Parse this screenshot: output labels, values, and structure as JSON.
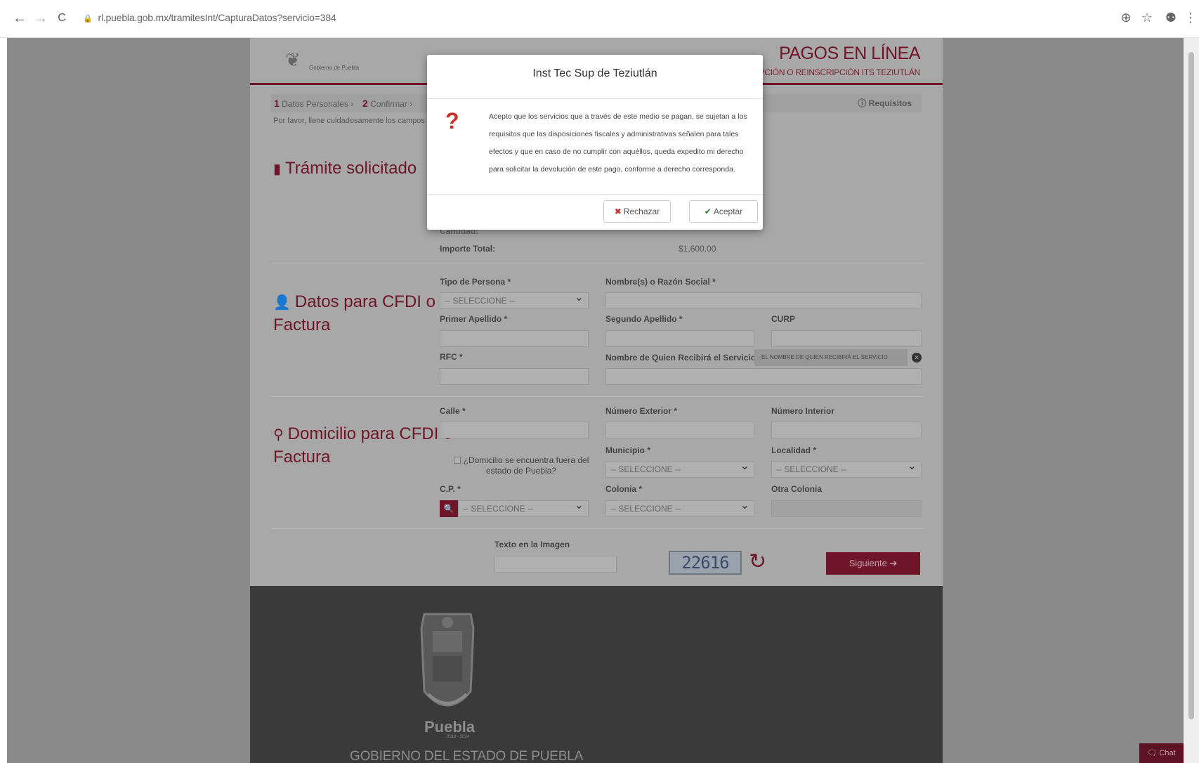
{
  "browser": {
    "url": "rl.puebla.gob.mx/tramitesInt/CapturaDatos?servicio=384",
    "back_icon": "←",
    "forward_icon": "→",
    "reload_icon": "C",
    "zoom_icon": "⊕",
    "star_icon": "☆",
    "profile_icon": "⚉",
    "menu_icon": "⋮"
  },
  "header": {
    "brand_title": "PAGOS EN LÍNEA",
    "brand_sub": "RIPCIÓN O REINSCRIPCIÓN ITS TEZIUTLÁN",
    "logo_text": "Gobierno de Puebla"
  },
  "steps": {
    "step1_num": "1",
    "step1_label": "Datos Personales",
    "step2_num": "2",
    "step2_label": "Confirmar",
    "requisitos": "Requisitos",
    "intro": "Por favor, llene cuidadosamente los campos"
  },
  "tramite": {
    "title": "Trámite solicitado",
    "cantidad_label": "Cantidad:",
    "importe_label": "Importe Total:",
    "importe_value": "$1,600.00"
  },
  "cfdi": {
    "title_line1": "Datos para CFDI o",
    "title_line2": "Factura",
    "tipo_persona_label": "Tipo de Persona *",
    "tipo_persona_value": "-- SELECCIONE --",
    "nombre_label": "Nombre(s) o Razón Social *",
    "primer_apellido_label": "Primer Apellido *",
    "segundo_apellido_label": "Segundo Apellido *",
    "curp_label": "CURP",
    "rfc_label": "RFC *",
    "recibe_label": "Nombre de Quien Recibirá el Servicio",
    "recibe_tag": "EL NOMBRE DE QUIEN RECIBIRÁ EL SERVICIO"
  },
  "domicilio": {
    "title_line1": "Domicilio para CFDI o",
    "title_line2": "Factura",
    "calle_label": "Calle *",
    "num_ext_label": "Número Exterior *",
    "num_int_label": "Número Interior",
    "fuera_line1": "¿Domicilio se encuentra fuera del",
    "fuera_line2": "estado de Puebla?",
    "municipio_label": "Municipio *",
    "municipio_value": "-- SELECCIONE --",
    "localidad_label": "Localidad *",
    "localidad_value": "-- SELECCIONE --",
    "cp_label": "C.P. *",
    "cp_value": "-- SELECCIONE --",
    "colonia_label": "Colonia *",
    "colonia_value": "-- SELECCIONE --",
    "otra_colonia_label": "Otra Colonia"
  },
  "captcha": {
    "label": "Texto en la Imagen",
    "code": "22616",
    "siguiente": "Siguiente ➔"
  },
  "footer": {
    "puebla": "Puebla",
    "years": "2019 - 2024",
    "gob": "GOBIERNO DEL ESTADO DE PUEBLA",
    "chat": "Chat"
  },
  "modal": {
    "title": "Inst Tec Sup de Teziutlán",
    "body_line1": "Acepto que los servicios que a través de este medio se pagan, se sujetan a los",
    "body_line2": "requisitos que las disposiciones fiscales y administrativas señalen para tales",
    "body_line3": "efectos y que en caso de no cumplir con aquéllos, queda expedito mi derecho",
    "body_line4": "para solicitar la devolución de este pago, conforme a derecho corresponda.",
    "reject": "Rechazar",
    "accept": "Aceptar"
  }
}
